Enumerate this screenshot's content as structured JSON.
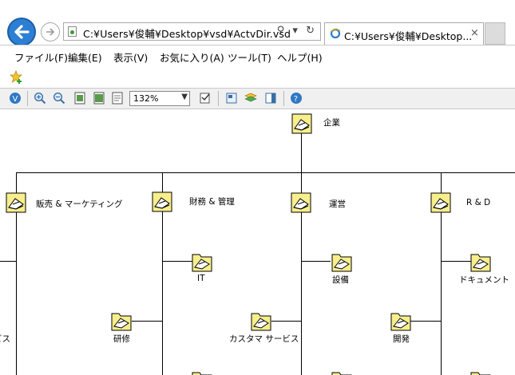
{
  "browser": {
    "address": "C:¥Users¥俊輔¥Desktop¥vsd¥ActvDir.vsd",
    "tab_title": "C:¥Users¥俊輔¥Desktop...",
    "tab_close": "×"
  },
  "menu": [
    {
      "label": "ファイル(F)"
    },
    {
      "label": "編集(E)"
    },
    {
      "label": "表示(V)"
    },
    {
      "label": "お気に入り(A)"
    },
    {
      "label": "ツール(T)"
    },
    {
      "label": "ヘルプ(H)"
    }
  ],
  "toolbar": {
    "zoom_value": "132%"
  },
  "diagram": {
    "root": "企業",
    "departments": [
      "販売 & マーケティング",
      "財務 & 管理",
      "運営",
      "R & D"
    ],
    "items": [
      "IT",
      "設備",
      "ドキュメント",
      "研修",
      "カスタマ サービス",
      "開発",
      "ビス"
    ]
  },
  "colors": {
    "node_fill": "#f7ee8c",
    "back_button": "#2d7fd3",
    "toolbar_bg": "#f0f0f0"
  }
}
